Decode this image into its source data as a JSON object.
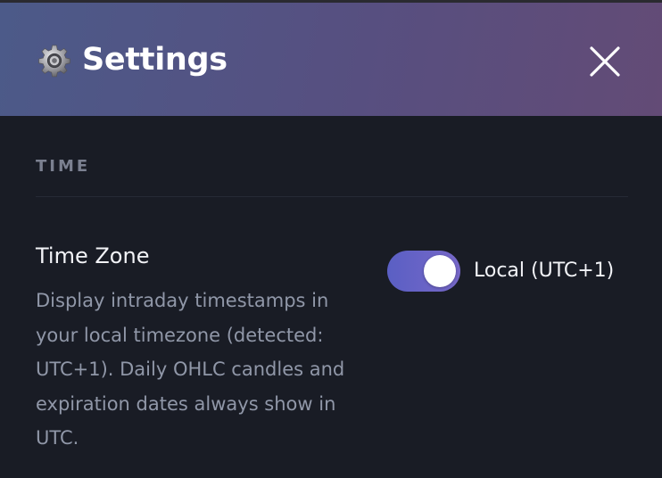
{
  "header": {
    "title": "Settings",
    "icon": "gear-icon",
    "close_icon": "close-icon"
  },
  "sections": [
    {
      "title": "TIME",
      "settings": [
        {
          "label": "Time Zone",
          "description": "Display intraday timestamps in your local timezone (detected: UTC+1). Daily OHLC candles and expiration dates always show in UTC.",
          "toggle": {
            "enabled": true,
            "value_label": "Local (UTC+1)"
          }
        }
      ]
    }
  ],
  "colors": {
    "accent": "#6a64c6",
    "header_gradient_start": "#4c5a89",
    "header_gradient_end": "#634b76",
    "background": "#191c25"
  }
}
